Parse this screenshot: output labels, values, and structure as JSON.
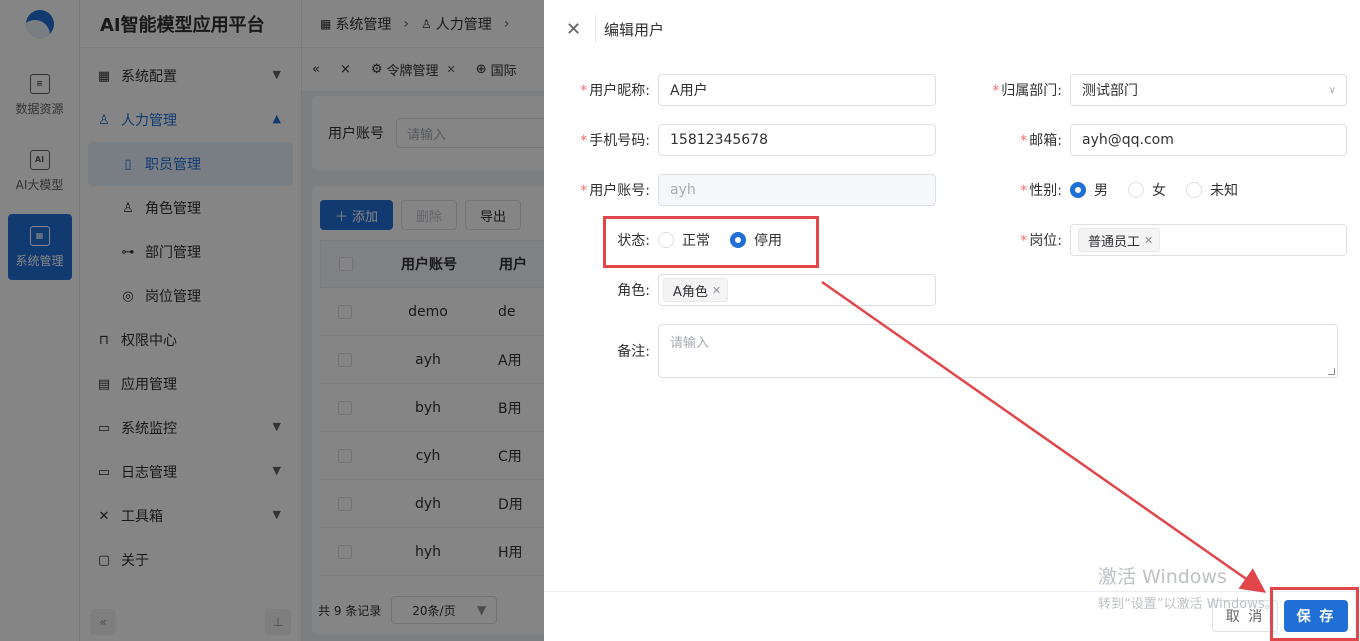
{
  "brand": "AI智能模型应用平台",
  "rail": [
    {
      "label": "数据资源",
      "icon": "database-icon"
    },
    {
      "label": "AI大模型",
      "icon": "ai-model-icon"
    },
    {
      "label": "系统管理",
      "icon": "system-icon"
    }
  ],
  "menu": {
    "system_config": "系统配置",
    "hr": "人力管理",
    "employee": "职员管理",
    "role": "角色管理",
    "dept": "部门管理",
    "post": "岗位管理",
    "perm": "权限中心",
    "app": "应用管理",
    "monitor": "系统监控",
    "log": "日志管理",
    "tools": "工具箱",
    "about": "关于"
  },
  "breadcrumb": [
    "系统管理",
    "人力管理"
  ],
  "tabs": [
    "令牌管理",
    "国际"
  ],
  "search": {
    "label": "用户账号",
    "placeholder": "请输入"
  },
  "toolbar": {
    "add": "添加",
    "delete": "删除",
    "export": "导出"
  },
  "table": {
    "headers": [
      "用户账号",
      "用户"
    ],
    "rows": [
      [
        "demo",
        "de"
      ],
      [
        "ayh",
        "A用"
      ],
      [
        "byh",
        "B用"
      ],
      [
        "cyh",
        "C用"
      ],
      [
        "dyh",
        "D用"
      ],
      [
        "hyh",
        "H用"
      ]
    ]
  },
  "pager": {
    "total": "共 9 条记录",
    "size": "20条/页"
  },
  "drawer": {
    "title": "编辑用户",
    "nickname_label": "用户昵称:",
    "nickname": "A用户",
    "dept_label": "归属部门:",
    "dept": "测试部门",
    "phone_label": "手机号码:",
    "phone": "15812345678",
    "email_label": "邮箱:",
    "email": "ayh@qq.com",
    "account_label": "用户账号:",
    "account": "ayh",
    "gender_label": "性别:",
    "gender_options": [
      "男",
      "女",
      "未知"
    ],
    "status_label": "状态:",
    "status_options": [
      "正常",
      "停用"
    ],
    "post_label": "岗位:",
    "post_tag": "普通员工",
    "role_label": "角色:",
    "role_tag": "A角色",
    "remark_label": "备注:",
    "remark_placeholder": "请输入",
    "cancel": "取 消",
    "save": "保 存"
  },
  "watermark": {
    "line1": "激活 Windows",
    "line2": "转到“设置”以激活 Windows。"
  },
  "colors": {
    "primary": "#1f6fd6",
    "annotation": "#e0464a"
  }
}
